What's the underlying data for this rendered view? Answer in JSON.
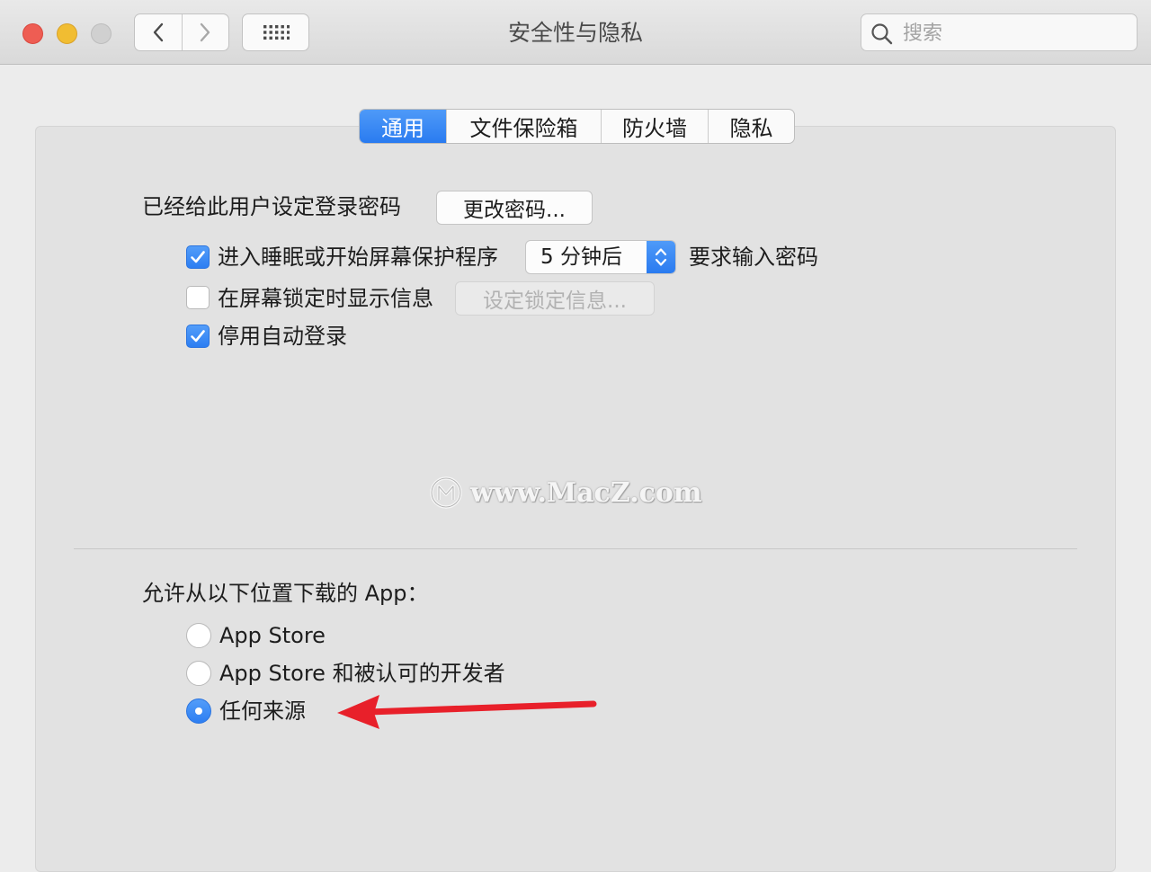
{
  "window": {
    "title": "安全性与隐私",
    "traffic_lights": [
      "close",
      "minimize",
      "zoom"
    ]
  },
  "toolbar": {
    "back_icon": "chevron-left-icon",
    "forward_icon": "chevron-right-icon",
    "grid_icon": "grid-icon",
    "search": {
      "placeholder": "搜索",
      "value": ""
    }
  },
  "tabs": [
    {
      "label": "通用",
      "active": true
    },
    {
      "label": "文件保险箱",
      "active": false
    },
    {
      "label": "防火墙",
      "active": false
    },
    {
      "label": "隐私",
      "active": false
    }
  ],
  "general": {
    "password_set_label": "已经给此用户设定登录密码",
    "change_password_button": "更改密码...",
    "require_password": {
      "checked": true,
      "label": "进入睡眠或开始屏幕保护程序",
      "delay_value": "5 分钟后",
      "suffix": "要求输入密码"
    },
    "lock_message": {
      "checked": false,
      "label": "在屏幕锁定时显示信息",
      "button": "设定锁定信息...",
      "button_enabled": false
    },
    "disable_auto_login": {
      "checked": true,
      "label": "停用自动登录"
    }
  },
  "watermark": "www.MacZ.com",
  "downloads": {
    "heading": "允许从以下位置下载的 App：",
    "options": [
      {
        "label": "App Store",
        "selected": false
      },
      {
        "label": "App Store 和被认可的开发者",
        "selected": false
      },
      {
        "label": "任何来源",
        "selected": true
      }
    ]
  },
  "annotation": {
    "arrow_color": "#e8202a"
  },
  "colors": {
    "accent": "#2a7bf0"
  }
}
